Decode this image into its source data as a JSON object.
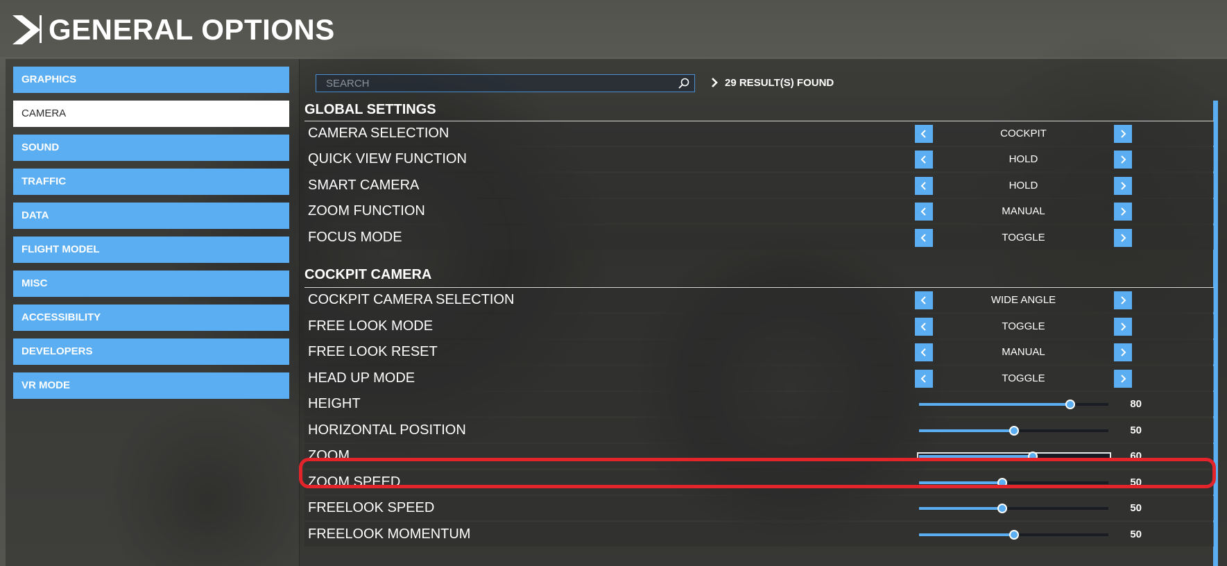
{
  "header": {
    "title": "GENERAL OPTIONS",
    "logo_icon": "chevron-logo-icon"
  },
  "sidebar": {
    "items": [
      {
        "label": "GRAPHICS",
        "active": false
      },
      {
        "label": "CAMERA",
        "active": true
      },
      {
        "label": "SOUND",
        "active": false
      },
      {
        "label": "TRAFFIC",
        "active": false
      },
      {
        "label": "DATA",
        "active": false
      },
      {
        "label": "FLIGHT MODEL",
        "active": false
      },
      {
        "label": "MISC",
        "active": false
      },
      {
        "label": "ACCESSIBILITY",
        "active": false
      },
      {
        "label": "DEVELOPERS",
        "active": false
      },
      {
        "label": "VR MODE",
        "active": false
      }
    ]
  },
  "search": {
    "placeholder": "SEARCH",
    "value": "",
    "icon": "search-icon",
    "results": "29 RESULT(S) FOUND"
  },
  "sections": [
    {
      "title": "GLOBAL SETTINGS",
      "rows": [
        {
          "label": "CAMERA SELECTION",
          "type": "selector",
          "value": "COCKPIT"
        },
        {
          "label": "QUICK VIEW FUNCTION",
          "type": "selector",
          "value": "HOLD"
        },
        {
          "label": "SMART CAMERA",
          "type": "selector",
          "value": "HOLD"
        },
        {
          "label": "ZOOM FUNCTION",
          "type": "selector",
          "value": "MANUAL"
        },
        {
          "label": "FOCUS MODE",
          "type": "selector",
          "value": "TOGGLE"
        }
      ]
    },
    {
      "title": "COCKPIT CAMERA",
      "rows": [
        {
          "label": "COCKPIT CAMERA SELECTION",
          "type": "selector",
          "value": "WIDE ANGLE"
        },
        {
          "label": "FREE LOOK MODE",
          "type": "selector",
          "value": "TOGGLE"
        },
        {
          "label": "FREE LOOK RESET",
          "type": "selector",
          "value": "MANUAL"
        },
        {
          "label": "HEAD UP MODE",
          "type": "selector",
          "value": "TOGGLE"
        },
        {
          "label": "HEIGHT",
          "type": "slider",
          "value": "80",
          "level": 0.8
        },
        {
          "label": "HORIZONTAL POSITION",
          "type": "slider",
          "value": "50",
          "level": 0.5
        },
        {
          "label": "ZOOM",
          "type": "slider",
          "value": "60",
          "level": 0.6,
          "highlighted": true
        },
        {
          "label": "ZOOM SPEED",
          "type": "slider",
          "value": "50",
          "level": 0.44
        },
        {
          "label": "FREELOOK SPEED",
          "type": "slider",
          "value": "50",
          "level": 0.44
        },
        {
          "label": "FREELOOK MOMENTUM",
          "type": "slider",
          "value": "50",
          "level": 0.5
        }
      ]
    }
  ],
  "colors": {
    "accent": "#5aaef1",
    "highlight": "#e3242b",
    "active_item": "#ffffff"
  }
}
